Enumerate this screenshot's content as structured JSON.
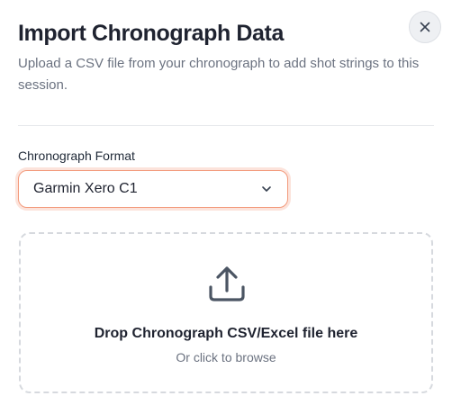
{
  "dialog": {
    "title": "Import Chronograph Data",
    "subtitle": "Upload a CSV file from your chronograph to add shot strings to this session.",
    "close_icon": "close-icon"
  },
  "format_field": {
    "label": "Chronograph Format",
    "selected_value": "Garmin Xero C1",
    "dropdown_icon": "chevron-down-icon",
    "focus_color": "#f39a7c"
  },
  "dropzone": {
    "icon": "upload-icon",
    "title": "Drop Chronograph CSV/Excel file here",
    "subtitle": "Or click to browse"
  }
}
